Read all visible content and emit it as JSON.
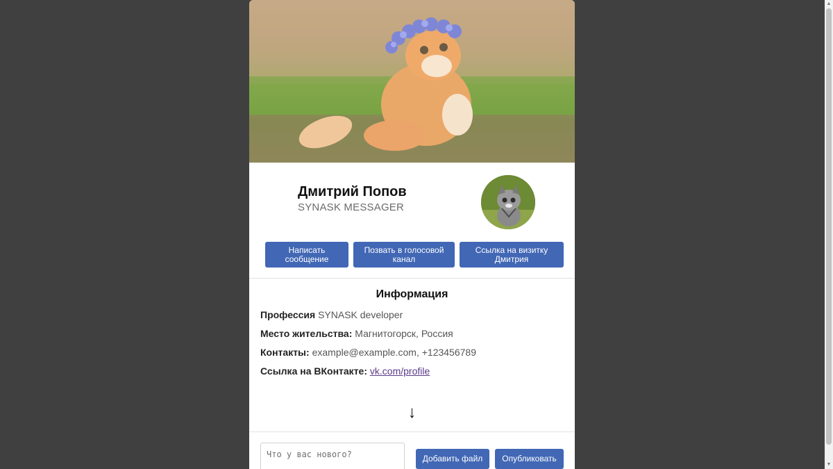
{
  "profile": {
    "name": "Дмитрий Попов",
    "subtitle": "SYNASK MESSAGER",
    "cover_image": "kitten-with-flower-crown",
    "avatar_image": "kitten-avatar"
  },
  "actions": {
    "message": "Написать сообщение",
    "voice": "Позвать в голосовой канал",
    "card_link": "Ссылка на визитку Дмитрия"
  },
  "info": {
    "title": "Информация",
    "rows": [
      {
        "label": "Профессия",
        "value": "SYNASK developer"
      },
      {
        "label": "Место жительства:",
        "value": "Магнитогорск, Россия"
      },
      {
        "label": "Контакты:",
        "value": "example@example.com, +123456789"
      },
      {
        "label": "Ссылка на ВКонтакте:",
        "value": "vk.com/profile"
      }
    ]
  },
  "scroll_hint_icon": "down-arrow-icon",
  "scroll_hint_glyph": "↓",
  "composer": {
    "placeholder": "Что у вас нового?",
    "add_file": "Добавить файл",
    "publish": "Опубликовать"
  },
  "colors": {
    "page_bg": "#404040",
    "card_bg": "#ffffff",
    "accent": "#4167b5",
    "link": "#5b3a8a"
  }
}
